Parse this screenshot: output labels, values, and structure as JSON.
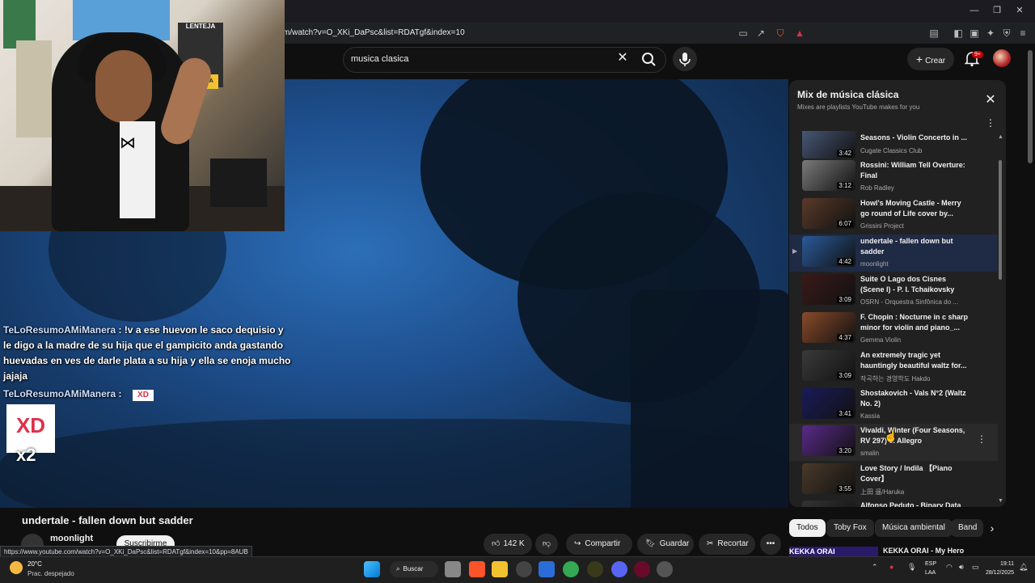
{
  "browser": {
    "url": "m/watch?v=O_XKi_DaPsc&list=RDATgf&index=10",
    "status_url": "https://www.youtube.com/watch?v=O_XKi_DaPsc&list=RDATgf&index=10&pp=8AUB",
    "window_controls": [
      "—",
      "❐",
      "✕"
    ]
  },
  "header": {
    "search_value": "musica clasica",
    "create_label": "Crear",
    "notif_badge": "9+"
  },
  "stream": {
    "chat": [
      {
        "user": "TeLoResumoAMiManera",
        "text": ": !v a ese huevon le saco dequisio y"
      },
      {
        "user": "",
        "text": "le digo a la madre de su hija que el gampicito anda gastando"
      },
      {
        "user": "",
        "text": "huevadas en ves de darle plata a su hija y ella se enoja mucho"
      },
      {
        "user": "",
        "text": "jajaja"
      },
      {
        "user": "TeLoResumoAMiManera",
        "text": ":"
      }
    ],
    "sticker_small": "XD",
    "sticker_big": "XD",
    "sticker_mult": "x2",
    "poster_text_1": "LENTEJA",
    "poster_text_2": "COCINA"
  },
  "video": {
    "title": "undertale - fallen down but sadder",
    "channel": "moonlight",
    "subscribe_label": "Suscribirme",
    "likes": "142 K",
    "share_label": "Compartir",
    "save_label": "Guardar",
    "clip_label": "Recortar"
  },
  "playlist": {
    "title": "Mix de música clásica",
    "subtitle": "Mixes are playlists YouTube makes for you",
    "items": [
      {
        "title": "Seasons - Violin Concerto in ...",
        "channel": "Cugate Classics Club",
        "duration": "3:42",
        "color": "#4a5a7a"
      },
      {
        "title": "Rossini: William Tell Overture: Final",
        "channel": "Rob Radley",
        "duration": "3:12",
        "color": "#7a7a7a"
      },
      {
        "title": "Howl's Moving Castle - Merry go round of Life cover by...",
        "channel": "Grissini Project",
        "duration": "6:07",
        "color": "#5a3a2a"
      },
      {
        "title": "undertale - fallen down but sadder",
        "channel": "moonlight",
        "duration": "4:42",
        "color": "#2a5a9a"
      },
      {
        "title": "Suite O Lago dos Cisnes (Scene I) - P. I. Tchaikovsky",
        "channel": "OSRN - Orquestra Sinfônica do ...",
        "duration": "3:09",
        "color": "#3a1a1a"
      },
      {
        "title": "F. Chopin : Nocturne in c sharp minor for violin and piano_...",
        "channel": "Gemma Violin",
        "duration": "4:37",
        "color": "#8a4a2a"
      },
      {
        "title": "An extremely tragic yet hauntingly beautiful waltz for...",
        "channel": "작곡하는 경영학도 Hakdo",
        "duration": "3:09",
        "color": "#3a3a3a"
      },
      {
        "title": "Shostakovich - Vals N°2 (Waltz No. 2)",
        "channel": "Kassia",
        "duration": "3:41",
        "color": "#1a1a5a"
      },
      {
        "title": "Vivaldi, Winter (Four Seasons, RV 297) 3. Allegro",
        "channel": "smalin",
        "duration": "3:20",
        "color": "#5a2a8a"
      },
      {
        "title": "Love Story / Indila 【Piano Cover】",
        "channel": "上田 遥/Haruka",
        "duration": "3:55",
        "color": "#4a3a2a"
      },
      {
        "title": "Alfonso Peduto - Binary Data IV",
        "channel": "",
        "duration": "",
        "color": "#333333"
      }
    ]
  },
  "chips": [
    "Todos",
    "Toby Fox",
    "Música ambiental",
    "Band"
  ],
  "next_video": {
    "thumb_text": "KEKKA ORAI",
    "title": "KEKKA ORAI - My Hero"
  },
  "taskbar": {
    "temp": "20°C",
    "weather": "Prac. despejado",
    "search_label": "Buscar",
    "lang1": "ESP",
    "lang2": "LAA",
    "time": "19:11",
    "date": "28/12/2025"
  }
}
